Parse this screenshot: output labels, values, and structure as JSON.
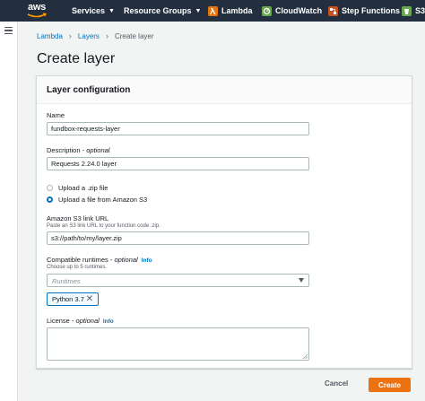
{
  "nav": {
    "logo": "aws",
    "services": "Services",
    "resource_groups": "Resource Groups",
    "favorites": [
      {
        "label": "Lambda",
        "icon": "lambda-icon",
        "color": "#e7750d"
      },
      {
        "label": "CloudWatch",
        "icon": "cloudwatch-icon",
        "color": "#6aa84f"
      },
      {
        "label": "Step Functions",
        "icon": "step-functions-icon",
        "color": "#c7511f"
      },
      {
        "label": "S3",
        "icon": "s3-icon",
        "color": "#6aa84f"
      }
    ],
    "bg_color": "#232f3e"
  },
  "breadcrumb": {
    "items": [
      "Lambda",
      "Layers"
    ],
    "current": "Create layer"
  },
  "page_title": "Create layer",
  "panel": {
    "title": "Layer configuration",
    "name": {
      "label": "Name",
      "value": "fundbox-requests-layer"
    },
    "description": {
      "label": "Description - ",
      "optional": "optional",
      "value": "Requests 2.24.0 layer"
    },
    "upload_options": [
      {
        "label": "Upload a .zip file",
        "selected": false
      },
      {
        "label": "Upload a file from Amazon S3",
        "selected": true
      }
    ],
    "s3_link": {
      "label": "Amazon S3 link URL",
      "hint": "Paste an S3 link URL to your function code .zip.",
      "value": "s3://path/to/my/layer.zip"
    },
    "runtimes": {
      "label": "Compatible runtimes - ",
      "optional": "optional",
      "info": "Info",
      "hint": "Choose up to 5 runtimes.",
      "placeholder": "Runtimes",
      "selected": [
        "Python 3.7"
      ]
    },
    "license": {
      "label": "License - ",
      "optional": "optional",
      "info": "Info",
      "value": ""
    }
  },
  "footer": {
    "cancel": "Cancel",
    "create": "Create",
    "create_color": "#ec7211"
  }
}
